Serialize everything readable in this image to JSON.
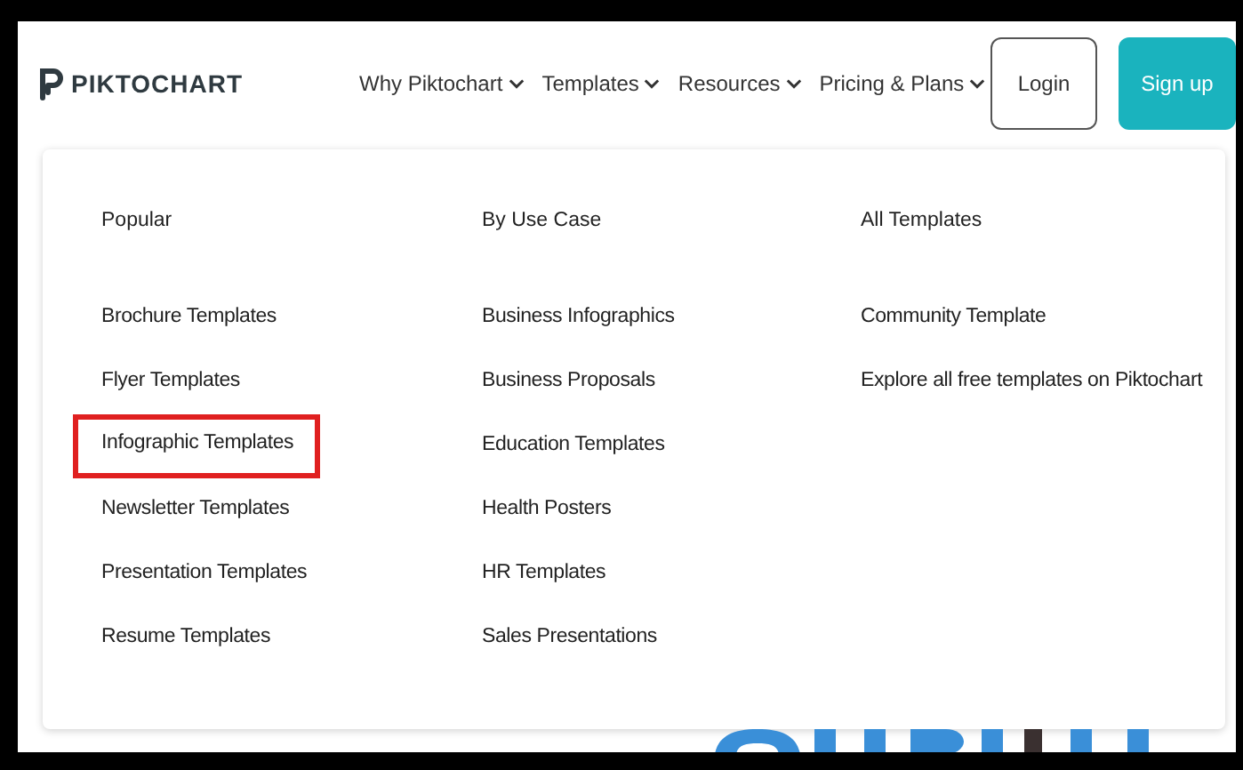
{
  "logo": {
    "text": "PIKTOCHART"
  },
  "nav": [
    {
      "label": "Why Piktochart",
      "has_menu": true
    },
    {
      "label": "Templates",
      "has_menu": true
    },
    {
      "label": "Resources",
      "has_menu": true
    },
    {
      "label": "Pricing & Plans",
      "has_menu": true
    }
  ],
  "buttons": [
    {
      "label": "Login",
      "kind": "outline"
    },
    {
      "label": "Sign up",
      "kind": "primary"
    }
  ],
  "menu_columns": [
    {
      "heading": "Popular",
      "items": [
        {
          "label": "Brochure Templates",
          "highlighted": false
        },
        {
          "label": "Flyer Templates",
          "highlighted": false
        },
        {
          "label": "Infographic Templates",
          "highlighted": true
        },
        {
          "label": "Newsletter Templates",
          "highlighted": false
        },
        {
          "label": "Presentation Templates",
          "highlighted": false
        },
        {
          "label": "Resume Templates",
          "highlighted": false
        }
      ]
    },
    {
      "heading": "By Use Case",
      "items": [
        {
          "label": "Business Infographics",
          "highlighted": false
        },
        {
          "label": "Business Proposals",
          "highlighted": false
        },
        {
          "label": "Education Templates",
          "highlighted": false
        },
        {
          "label": "Health Posters",
          "highlighted": false
        },
        {
          "label": "HR Templates",
          "highlighted": false
        },
        {
          "label": "Sales Presentations",
          "highlighted": false
        }
      ]
    },
    {
      "heading": "All Templates",
      "items": [
        {
          "label": "Community Template",
          "highlighted": false
        },
        {
          "label": "Explore all free templates on Piktochart",
          "highlighted": false
        }
      ]
    }
  ]
}
